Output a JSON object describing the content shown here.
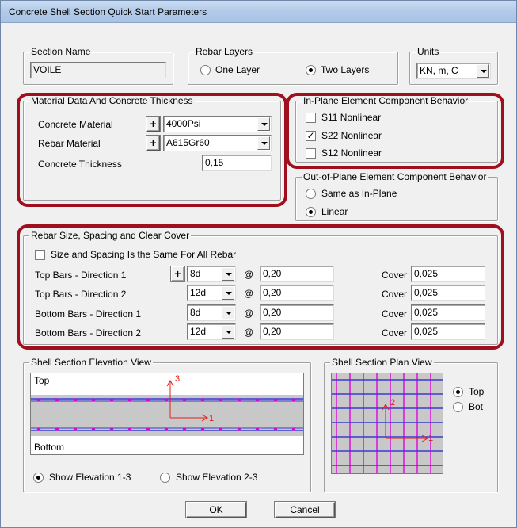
{
  "window": {
    "title": "Concrete Shell Section Quick Start Parameters"
  },
  "section_name": {
    "label": "Section Name",
    "value": "VOILE"
  },
  "rebar_layers": {
    "label": "Rebar Layers",
    "one": "One Layer",
    "two": "Two Layers",
    "selected": "two"
  },
  "units": {
    "label": "Units",
    "value": "KN, m, C"
  },
  "material": {
    "label": "Material Data And Concrete Thickness",
    "concrete_label": "Concrete Material",
    "concrete_value": "4000Psi",
    "rebar_label": "Rebar Material",
    "rebar_value": "A615Gr60",
    "thickness_label": "Concrete Thickness",
    "thickness_value": "0,15",
    "plus": "+"
  },
  "in_plane": {
    "label": "In-Plane Element Component Behavior",
    "items": [
      {
        "label": "S11 Nonlinear",
        "checked": false
      },
      {
        "label": "S22 Nonlinear",
        "checked": true
      },
      {
        "label": "S12 Nonlinear",
        "checked": false
      }
    ]
  },
  "out_of_plane": {
    "label": "Out-of-Plane Element Component Behavior",
    "same": "Same as In-Plane",
    "linear": "Linear",
    "selected": "linear"
  },
  "rebar": {
    "label": "Rebar Size, Spacing and Clear Cover",
    "same_label": "Size and Spacing Is the Same For All Rebar",
    "at": "@",
    "cover_label": "Cover",
    "plus": "+",
    "rows": [
      {
        "label": "Top Bars  -  Direction 1",
        "size": "8d",
        "spacing": "0,20",
        "cover": "0,025"
      },
      {
        "label": "Top Bars  -  Direction 2",
        "size": "12d",
        "spacing": "0,20",
        "cover": "0,025"
      },
      {
        "label": "Bottom Bars  -  Direction 1",
        "size": "8d",
        "spacing": "0,20",
        "cover": "0,025"
      },
      {
        "label": "Bottom Bars  -  Direction 2",
        "size": "12d",
        "spacing": "0,20",
        "cover": "0,025"
      }
    ]
  },
  "elevation": {
    "label": "Shell Section Elevation View",
    "top": "Top",
    "bottom": "Bottom",
    "axis_up": "3",
    "axis_right": "1",
    "opt1": "Show Elevation 1-3",
    "opt2": "Show Elevation 2-3",
    "selected": "1-3"
  },
  "plan": {
    "label": "Shell Section Plan View",
    "axis_up": "2",
    "axis_right": "1",
    "top": "Top",
    "bot": "Bot",
    "selected": "top"
  },
  "buttons": {
    "ok": "OK",
    "cancel": "Cancel"
  },
  "colors": {
    "highlight": "#a00f1e",
    "rebar_line": "#3a3ad0",
    "rebar_dot": "#e000e0",
    "axis": "#e02020",
    "concrete": "#c8c8c8"
  }
}
